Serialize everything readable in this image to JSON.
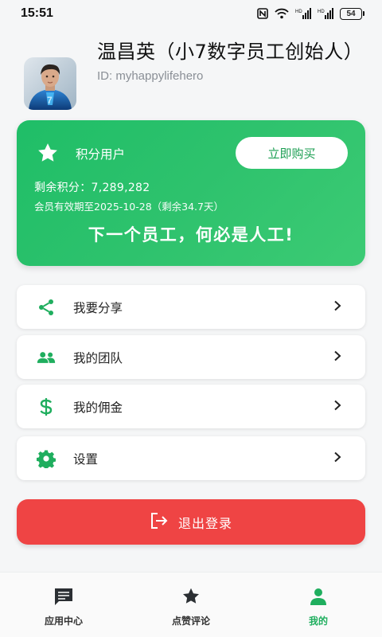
{
  "status_bar": {
    "time": "15:51",
    "battery": "54"
  },
  "profile": {
    "name": "温昌英（小7数字员工创始人）",
    "id_text": "ID: myhappylifehero"
  },
  "member_card": {
    "title": "积分用户",
    "buy_label": "立即购买",
    "points_text": "剩余积分：7,289,282",
    "expiry_text": "会员有效期至2025-10-28（剩余34.7天）",
    "slogan": "下一个员工，何必是人工!",
    "gradient_colors": [
      "#1fbe67",
      "#3ccb74"
    ]
  },
  "menu": [
    {
      "label": "我要分享",
      "icon": "share-icon"
    },
    {
      "label": "我的团队",
      "icon": "group-icon"
    },
    {
      "label": "我的佣金",
      "icon": "dollar-icon"
    },
    {
      "label": "设置",
      "icon": "gear-icon"
    }
  ],
  "logout": {
    "label": "退出登录",
    "icon": "logout-icon",
    "color": "#ef4444"
  },
  "bottom_nav": [
    {
      "label": "应用中心",
      "icon": "chat-icon",
      "active": false
    },
    {
      "label": "点赞评论",
      "icon": "star-icon",
      "active": false
    },
    {
      "label": "我的",
      "icon": "person-icon",
      "active": true
    }
  ],
  "colors": {
    "accent": "#1fae5e",
    "danger": "#ef4444",
    "background": "#f5f6f7"
  }
}
